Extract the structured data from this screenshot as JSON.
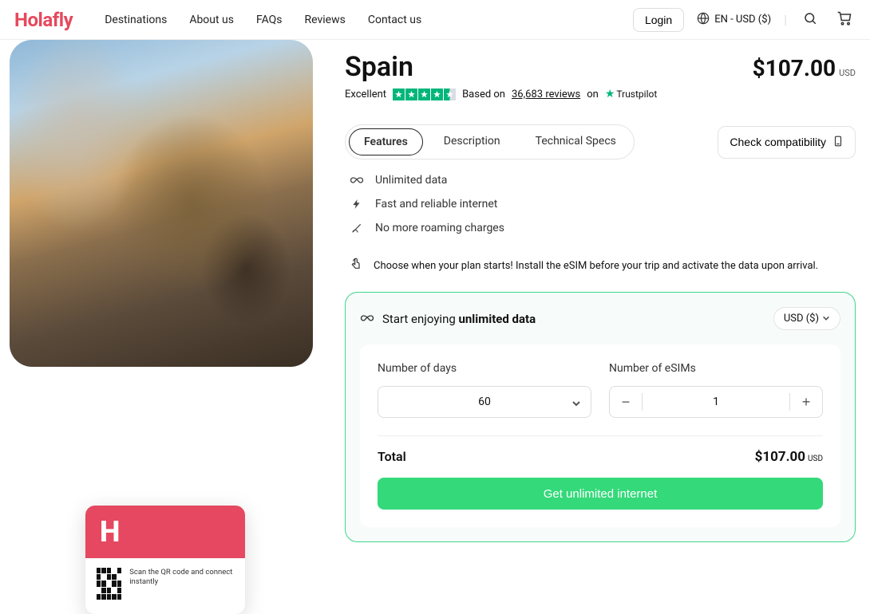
{
  "brand": "Holafly",
  "nav": {
    "destinations": "Destinations",
    "about": "About us",
    "faqs": "FAQs",
    "reviews": "Reviews",
    "contact": "Contact us"
  },
  "header": {
    "login": "Login",
    "locale": "EN - USD ($)"
  },
  "product": {
    "title": "Spain",
    "price": "$107.00",
    "currency": "USD",
    "rating_label": "Excellent",
    "based_on": "Based on",
    "reviews_count": "36,683 reviews",
    "on": "on",
    "trustpilot": "Trustpilot"
  },
  "tabs": {
    "features": "Features",
    "description": "Description",
    "tech": "Technical Specs"
  },
  "compat": "Check compatibility",
  "features": {
    "f1": "Unlimited data",
    "f2": "Fast and reliable internet",
    "f3": "No more roaming charges"
  },
  "note": "Choose when your plan starts! Install the eSIM before your trip and activate the data upon arrival.",
  "panel": {
    "start_prefix": "Start enjoying ",
    "start_bold": "unlimited data",
    "currency_pill": "USD ($)",
    "days_label": "Number of days",
    "days_value": "60",
    "esims_label": "Number of eSIMs",
    "esims_value": "1",
    "total_label": "Total",
    "total_amount": "$107.00",
    "total_currency": "USD",
    "cta": "Get unlimited internet"
  },
  "card": {
    "qr_text": "Scan the QR code and connect instantly"
  }
}
